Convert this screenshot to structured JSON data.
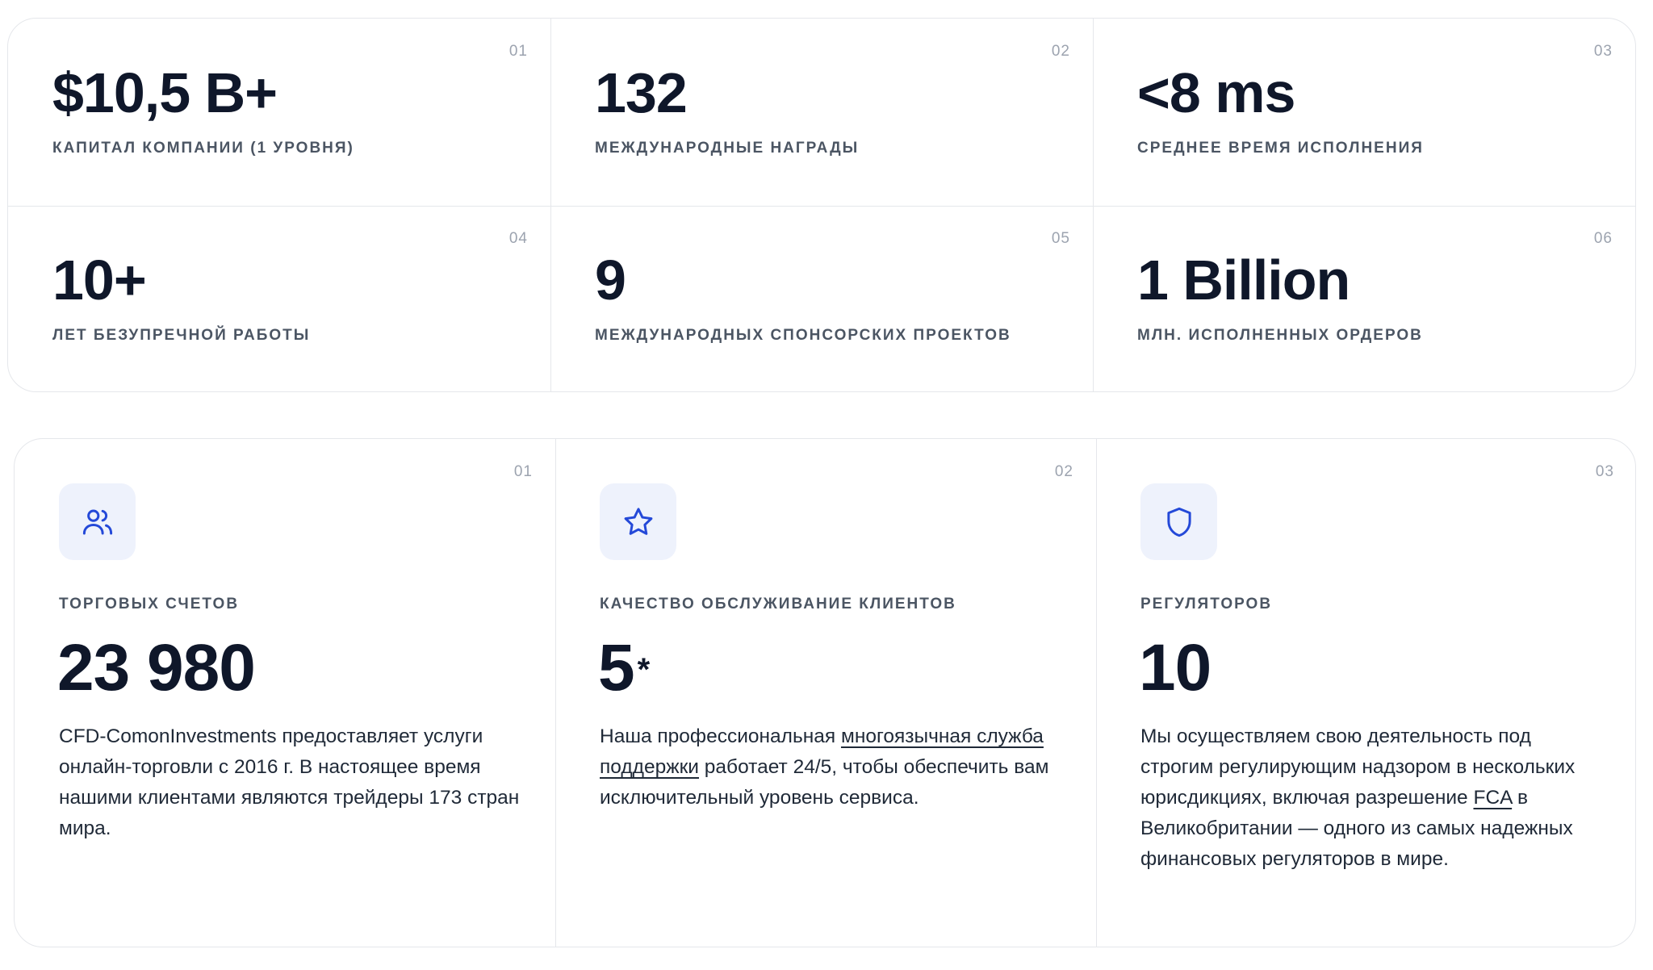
{
  "stats": [
    {
      "index": "01",
      "value": "$10,5 B+",
      "label": "КАПИТАЛ КОМПАНИИ (1 УРОВНЯ)"
    },
    {
      "index": "02",
      "value": "132",
      "label": "МЕЖДУНАРОДНЫЕ НАГРАДЫ"
    },
    {
      "index": "03",
      "value": "<8 ms",
      "label": "СРЕДНЕЕ ВРЕМЯ ИСПОЛНЕНИЯ"
    },
    {
      "index": "04",
      "value": "10+",
      "label": "ЛЕТ БЕЗУПРЕЧНОЙ РАБОТЫ"
    },
    {
      "index": "05",
      "value": "9",
      "label": "МЕЖДУНАРОДНЫХ СПОНСОРСКИХ ПРОЕКТОВ"
    },
    {
      "index": "06",
      "value": "1 Billion",
      "label": "МЛН. ИСПОЛНЕННЫХ ОРДЕРОВ"
    }
  ],
  "features": [
    {
      "index": "01",
      "icon": "users-icon",
      "label": "ТОРГОВЫХ СЧЕТОВ",
      "value": "23 980",
      "text": "CFD-ComonInvestments предоставляет услуги онлайн-торговли с 2016 г. В настоящее время нашими клиентами являются трейдеры 173 стран мира."
    },
    {
      "index": "02",
      "icon": "star-icon",
      "label": "КАЧЕСТВО ОБСЛУЖИВАНИЕ КЛИЕНТОВ",
      "value": "5",
      "value_suffix": "*",
      "text_before": "Наша профессиональная ",
      "text_link": "многоязычная служба поддержки",
      "text_after": " работает 24/5, чтобы обеспечить вам исключительный уровень сервиса."
    },
    {
      "index": "03",
      "icon": "shield-icon",
      "label": "РЕГУЛЯТОРОВ",
      "value": "10",
      "text_before": "Мы осуществляем свою деятельность под строгим регулирующим надзором в нескольких юрисдикциях, включая разрешение ",
      "text_link": "FCA",
      "text_after": " в Великобритании — одного из самых надежных финансовых регуляторов в мире."
    }
  ],
  "colors": {
    "accent": "#2449d8",
    "icon_bg": "#eef2fc",
    "text_dark": "#0f172a",
    "label_gray": "#4b5563",
    "border": "#e5e7eb"
  }
}
